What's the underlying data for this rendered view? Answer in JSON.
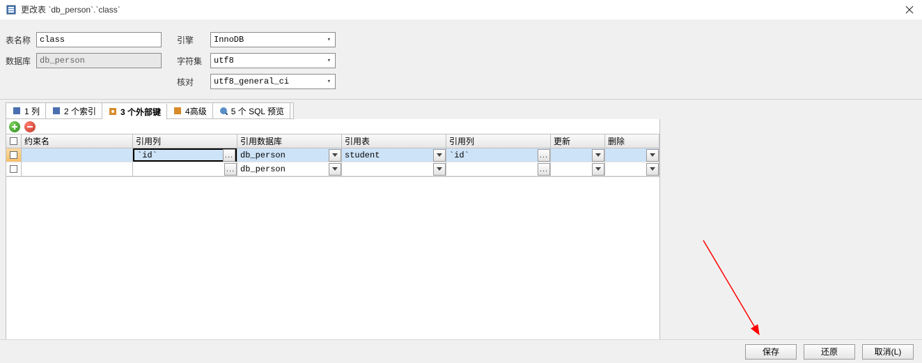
{
  "window": {
    "title": "更改表 `db_person`.`class`"
  },
  "form": {
    "table_name_label": "表名称",
    "table_name_value": "class",
    "database_label": "数据库",
    "database_value": "db_person",
    "engine_label": "引擎",
    "engine_value": "InnoDB",
    "charset_label": "字符集",
    "charset_value": "utf8",
    "collation_label": "核对",
    "collation_value": "utf8_general_ci"
  },
  "tabs": {
    "cols": "1 列",
    "indexes": "2 个索引",
    "fks": "3 个外部键",
    "adv": "4高级",
    "sql": "5 个 SQL 预览"
  },
  "grid": {
    "headers": {
      "constraint": "约束名",
      "refcol": "引用列",
      "refdb": "引用数据库",
      "reftab": "引用表",
      "refcol2": "引用列",
      "onupd": "更新",
      "ondel": "删除"
    },
    "rows": [
      {
        "constraint": "",
        "refcol": "`id`",
        "refdb": "db_person",
        "reftab": "student",
        "refcol2": "`id`",
        "onupd": "",
        "ondel": ""
      },
      {
        "constraint": "",
        "refcol": "",
        "refdb": "db_person",
        "reftab": "",
        "refcol2": "",
        "onupd": "",
        "ondel": ""
      }
    ]
  },
  "buttons": {
    "save": "保存",
    "revert": "还原",
    "cancel": "取消(L)"
  }
}
